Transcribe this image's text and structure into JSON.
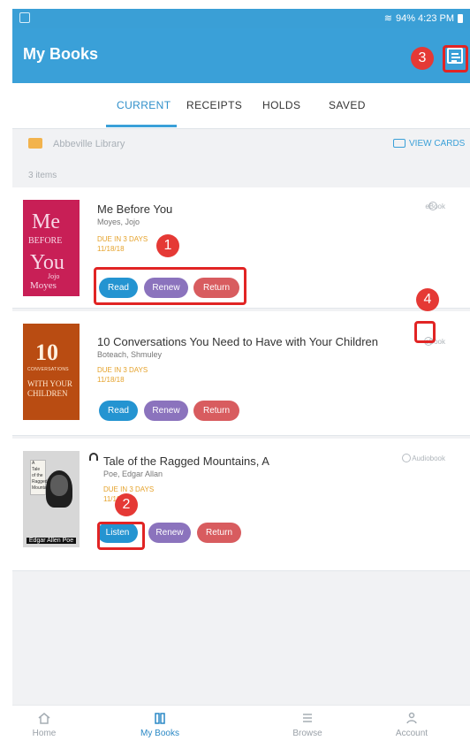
{
  "status_bar": {
    "right_text": "94% 4:23 PM"
  },
  "app_bar": {
    "title": "My Books",
    "filter_icon": "filter-icon"
  },
  "tabs": [
    {
      "label": "CURRENT",
      "active": true
    },
    {
      "label": "RECEIPTS",
      "active": false
    },
    {
      "label": "HOLDS",
      "active": false
    },
    {
      "label": "SAVED",
      "active": false
    }
  ],
  "library": {
    "name": "Abbeville Library",
    "view_cards": "VIEW CARDS"
  },
  "items_count": "3 items",
  "books": [
    {
      "title": "Me Before You",
      "author": "Moyes, Jojo",
      "due": "DUE IN 3 DAYS",
      "date": "11/18/18",
      "format": "eBook",
      "actions": [
        "Read",
        "Renew",
        "Return"
      ]
    },
    {
      "title": "10 Conversations You Need to Have with Your Children",
      "author": "Boteach, Shmuley",
      "due": "DUE IN 3 DAYS",
      "date": "11/18/18",
      "format": "eBook",
      "actions": [
        "Read",
        "Renew",
        "Return"
      ]
    },
    {
      "title": "Tale of the Ragged Mountains, A",
      "author": "Poe, Edgar Allan",
      "due": "DUE IN 3 DAYS",
      "date": "11/18/18",
      "format": "Audiobook",
      "actions": [
        "Listen",
        "Renew",
        "Return"
      ]
    }
  ],
  "cover_text": {
    "book1": [
      "Me",
      "BEFORE",
      "You",
      "Jojo",
      "Moyes"
    ],
    "book2": [
      "10",
      "CONVERSATIONS",
      "WITH YOUR",
      "CHILDREN"
    ],
    "book3_top": [
      "A",
      "Tale",
      "of the",
      "Ragged",
      "Mountains"
    ],
    "book3_bottom": "Edgar Allen Poe"
  },
  "annotations": [
    "1",
    "2",
    "3",
    "4"
  ],
  "bottom_nav": [
    {
      "label": "Home",
      "icon": "home-icon",
      "active": false
    },
    {
      "label": "My Books",
      "icon": "book-icon",
      "active": true
    },
    {
      "label": "Browse",
      "icon": "list-icon",
      "active": false
    },
    {
      "label": "Account",
      "icon": "account-icon",
      "active": false
    }
  ]
}
